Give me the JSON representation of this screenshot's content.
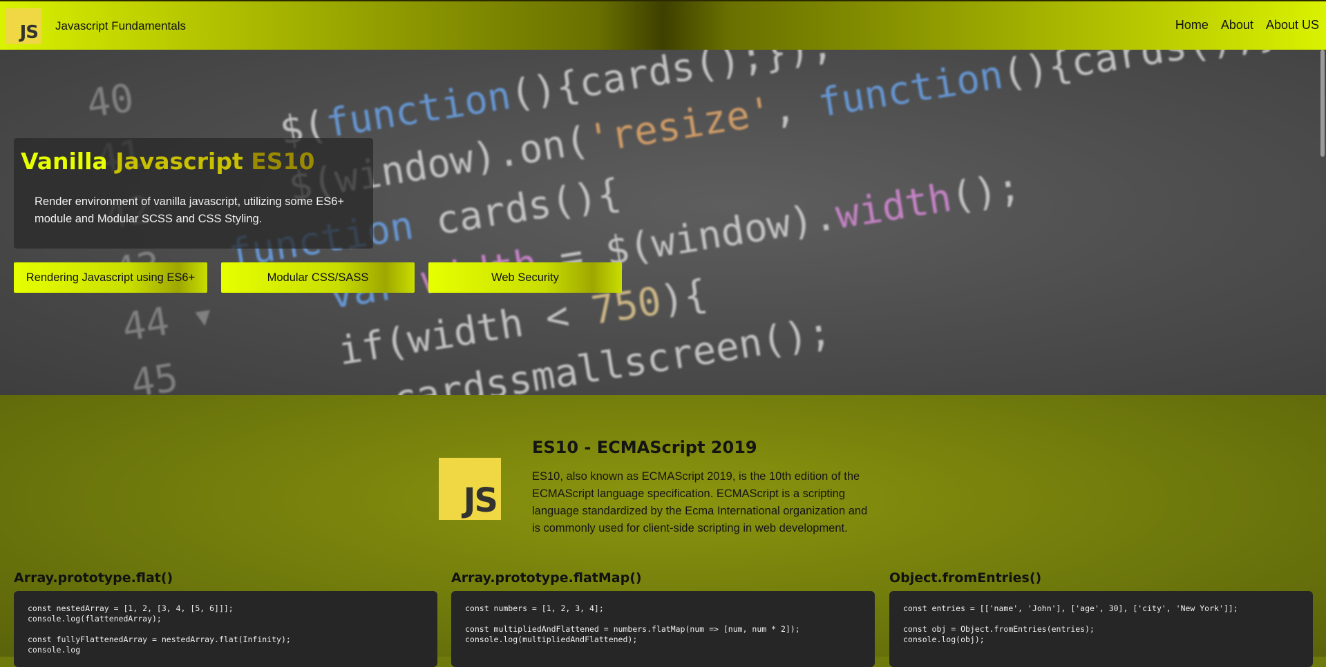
{
  "navbar": {
    "logo_text": "JS",
    "brand": "Javascript Fundamentals",
    "links": [
      "Home",
      "About",
      "About US"
    ]
  },
  "hero": {
    "title_part1": "Vanilla",
    "title_part2": "Javascript",
    "title_part3": "ES10",
    "description": "Render environment of vanilla javascript, utilizing some ES6+ module and Modular SCSS and CSS Styling.",
    "buttons": [
      "Rendering Javascript using ES6+",
      "Modular CSS/SASS",
      "Web Security"
    ]
  },
  "intro": {
    "logo_text": "JS",
    "title": "ES10 - ECMAScript 2019",
    "description": "ES10, also known as ECMAScript 2019, is the 10th edition of the ECMAScript language specification. ECMAScript is a scripting language standardized by the Ecma International organization and is commonly used for client-side scripting in web development."
  },
  "cards": [
    {
      "title": "Array.prototype.flat()",
      "code": "const nestedArray = [1, 2, [3, 4, [5, 6]]];\nconsole.log(flattenedArray);\n\nconst fullyFlattenedArray = nestedArray.flat(Infinity);\nconsole.log"
    },
    {
      "title": "Array.prototype.flatMap()",
      "code": "const numbers = [1, 2, 3, 4];\n\nconst multipliedAndFlattened = numbers.flatMap(num => [num, num * 2]);\nconsole.log(multipliedAndFlattened);"
    },
    {
      "title": "Object.fromEntries()",
      "code": "const entries = [['name', 'John'], ['age', 30], ['city', 'New York']];\n\nconst obj = Object.fromEntries(entries);\nconsole.log(obj);"
    }
  ],
  "colors": {
    "accent": "#e6ff00",
    "js_logo": "#f0d845",
    "olive_bg": "#6f7a0c",
    "code_bg": "#262626"
  }
}
